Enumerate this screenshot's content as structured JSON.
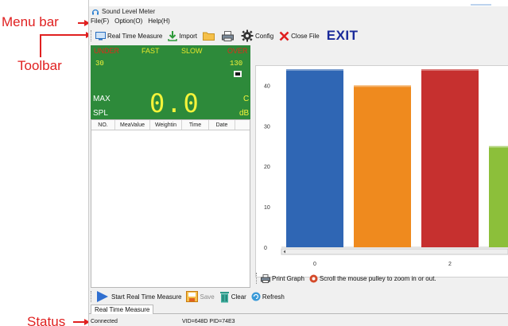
{
  "annotations": {
    "menu_bar": "Menu bar",
    "toolbar": "Toolbar",
    "status": "Status"
  },
  "window": {
    "title": "Sound Level Meter",
    "icon": "headphones-icon"
  },
  "menu": {
    "items": [
      "File(F)",
      "Option(O)",
      "Help(H)"
    ]
  },
  "toolbar": {
    "real_time": "Real Time Measure",
    "import": "Import",
    "open_icon": "folder-icon",
    "print_icon": "printer-icon",
    "config": "Config",
    "close_file": "Close File",
    "exit": "EXIT"
  },
  "meter": {
    "under": "UNDER",
    "fast": "FAST",
    "slow": "SLOW",
    "over": "OVER",
    "range_low": "30",
    "range_high": "130",
    "max": "MAX",
    "spl": "SPL",
    "weighting": "C",
    "unit": "dB",
    "value": "0.0",
    "colors": {
      "background": "#2d8a3a",
      "indicator_red": "#e02a1a",
      "indicator_yellow": "#e8e82a"
    }
  },
  "table": {
    "columns": [
      "NO.",
      "MeaValue",
      "Weightin",
      "Time",
      "Date"
    ],
    "rows": []
  },
  "chart_data": {
    "type": "bar",
    "x": [
      0,
      1,
      2,
      3
    ],
    "values": [
      44,
      40,
      44,
      25
    ],
    "colors": [
      "#2f66b4",
      "#ef8a1e",
      "#c6302f",
      "#8cbf3a"
    ],
    "yticks": [
      0,
      10,
      20,
      30,
      40
    ],
    "xticks": [
      0,
      2
    ],
    "ylim": [
      0,
      44
    ],
    "grid": false
  },
  "chart_footer": {
    "print_graph": "Print Graph",
    "hint": "Scroll the mouse pulley to zoom in or out."
  },
  "bottom_toolbar": {
    "start": "Start Real Time Measure",
    "save": "Save",
    "clear": "Clear",
    "refresh": "Refresh"
  },
  "tabs": [
    "Real Time Measure"
  ],
  "status": {
    "connection": "Connected",
    "device": "VID=648D PID=74E3"
  }
}
